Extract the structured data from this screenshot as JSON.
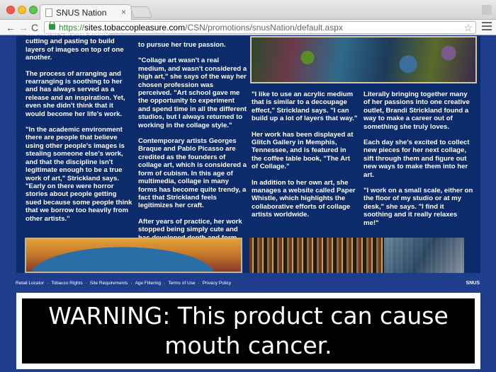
{
  "browser": {
    "tab_title": "SNUS Nation",
    "tab_close": "×",
    "url_scheme": "https://",
    "url_host": "sites.tobaccopleasure.com",
    "url_path": "/CSN/promotions/snusNation/default.aspx",
    "back": "←",
    "forward": "→",
    "reload": "C",
    "star": "☆"
  },
  "article": {
    "col1": [
      "The North Carolina studio cutting and pasting to build layers of images on top of one another.",
      "The process of arranging and rearranging is soothing to her and has always served as a release and an inspiration. Yet, even she didn't think that it would become her life's work.",
      "\"In the academic environment there are people that believe using other people's images is stealing someone else's work, and that the discipline isn't legitimate enough to be a true work of art,\" Strickland says.",
      "\"Early on there were horror stories about people getting sued because some people think that we borrow too heavily from other artists.\""
    ],
    "col2": [
      "to pursue her true passion.",
      "\"Collage art wasn't a real medium, and wasn't considered a high art,\" she says of the way her chosen profession was perceived. \"Art school gave me the opportunity to experiment and spend time in all the different studios, but I always returned to working in the collage style.\"",
      "Contemporary artists Georges Braque and Pablo Picasso are credited as the founders of collage art, which is considered a form of cubism. In this age of multimedia, collage in many forms has become quite trendy, a fact that Strickland feels legitimizes her craft.",
      "After years of practice, her work stopped being simply cute and has developed depth and form."
    ],
    "col3": [
      "\"I like to use an acrylic medium that is similar to a decoupage effect,\" Strickland says. \"I can build up a lot of layers that way.\"",
      "Her work has been displayed at Glitch Gallery in Memphis, Tennessee, and is featured in the coffee table book, \"The Art of Collage.\"",
      "In addition to her own art, she manages a website called Paper Whistle, which highlights the collaborative efforts of collage artists worldwide."
    ],
    "col4": [
      "Literally bringing together many of her passions into one creative outlet, Brandi Strickland found a way to make a career out of something she truly loves.",
      "Each day she's excited to collect new pieces for her next collage, sift through them and figure out new ways to make them into her art.",
      "\"I work on a small scale, either on the floor of my studio or at my desk,\" she says. \"I find it soothing and it really relaxes me!\""
    ]
  },
  "footer": {
    "links": [
      "Retail Locator",
      "Tobacco Rights",
      "Site Requirements",
      "Age Filtering",
      "Terms of Use",
      "Privacy Policy"
    ],
    "separator": "·",
    "brand": "SNUS"
  },
  "warning": {
    "text": "WARNING: This product can cause mouth cancer."
  }
}
